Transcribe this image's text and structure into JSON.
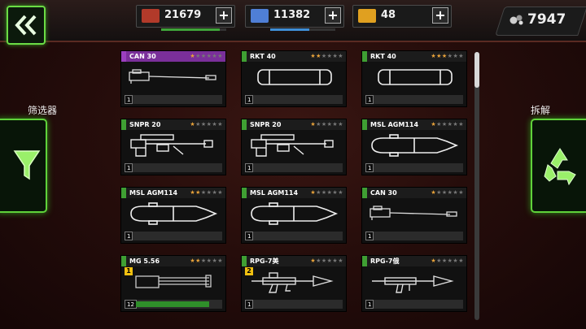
{
  "resources": [
    {
      "value": "21679",
      "icon": "crate-icon",
      "color": "#b23a2a",
      "bar_color": "#3fa43a",
      "bar_fraction": 0.9
    },
    {
      "value": "11382",
      "icon": "steel-icon",
      "color": "#4f7fd6",
      "bar_color": "#3f8fd6",
      "bar_fraction": 0.6
    },
    {
      "value": "48",
      "icon": "gold-bars-icon",
      "color": "#e0a020",
      "bar_color": "#333333",
      "bar_fraction": 0.0
    }
  ],
  "plus_label": "+",
  "gems": {
    "value": "7947",
    "icon": "gems-icon"
  },
  "filter": {
    "label": "筛选器",
    "icon": "funnel-icon"
  },
  "dismantle": {
    "label": "拆解",
    "icon": "recycle-icon"
  },
  "colors": {
    "green": "#6bdc45",
    "rare": "#9b3fbf",
    "common": "#3f9f33"
  },
  "items": [
    {
      "name": "CAN 30",
      "stars": 1,
      "rarity": "rare",
      "weapon": "cannon",
      "qty": "1",
      "progress": 0,
      "level": ""
    },
    {
      "name": "RKT 40",
      "stars": 2,
      "rarity": "common",
      "weapon": "rocket",
      "qty": "1",
      "progress": 0,
      "level": ""
    },
    {
      "name": "RKT 40",
      "stars": 3,
      "rarity": "common",
      "weapon": "rocket",
      "qty": "1",
      "progress": 0,
      "level": ""
    },
    {
      "name": "SNPR 20",
      "stars": 1,
      "rarity": "common",
      "weapon": "sniper",
      "qty": "1",
      "progress": 0,
      "level": ""
    },
    {
      "name": "SNPR 20",
      "stars": 1,
      "rarity": "common",
      "weapon": "sniper",
      "qty": "1",
      "progress": 0,
      "level": ""
    },
    {
      "name": "MSL AGM114",
      "stars": 1,
      "rarity": "common",
      "weapon": "missile",
      "qty": "1",
      "progress": 0,
      "level": ""
    },
    {
      "name": "MSL AGM114",
      "stars": 2,
      "rarity": "common",
      "weapon": "missile",
      "qty": "1",
      "progress": 0,
      "level": ""
    },
    {
      "name": "MSL AGM114",
      "stars": 1,
      "rarity": "common",
      "weapon": "missile",
      "qty": "1",
      "progress": 0,
      "level": ""
    },
    {
      "name": "CAN 30",
      "stars": 1,
      "rarity": "common",
      "weapon": "cannon",
      "qty": "1",
      "progress": 0,
      "level": ""
    },
    {
      "name": "MG 5.56",
      "stars": 2,
      "rarity": "common",
      "weapon": "minigun",
      "qty": "12",
      "progress": 0.85,
      "level": "1"
    },
    {
      "name": "RPG-7美",
      "stars": 1,
      "rarity": "common",
      "weapon": "rpg",
      "qty": "1",
      "progress": 0,
      "level": "2"
    },
    {
      "name": "RPG-7俄",
      "stars": 1,
      "rarity": "common",
      "weapon": "rpg2",
      "qty": "1",
      "progress": 0,
      "level": ""
    }
  ],
  "scroll_fraction": 0.13
}
